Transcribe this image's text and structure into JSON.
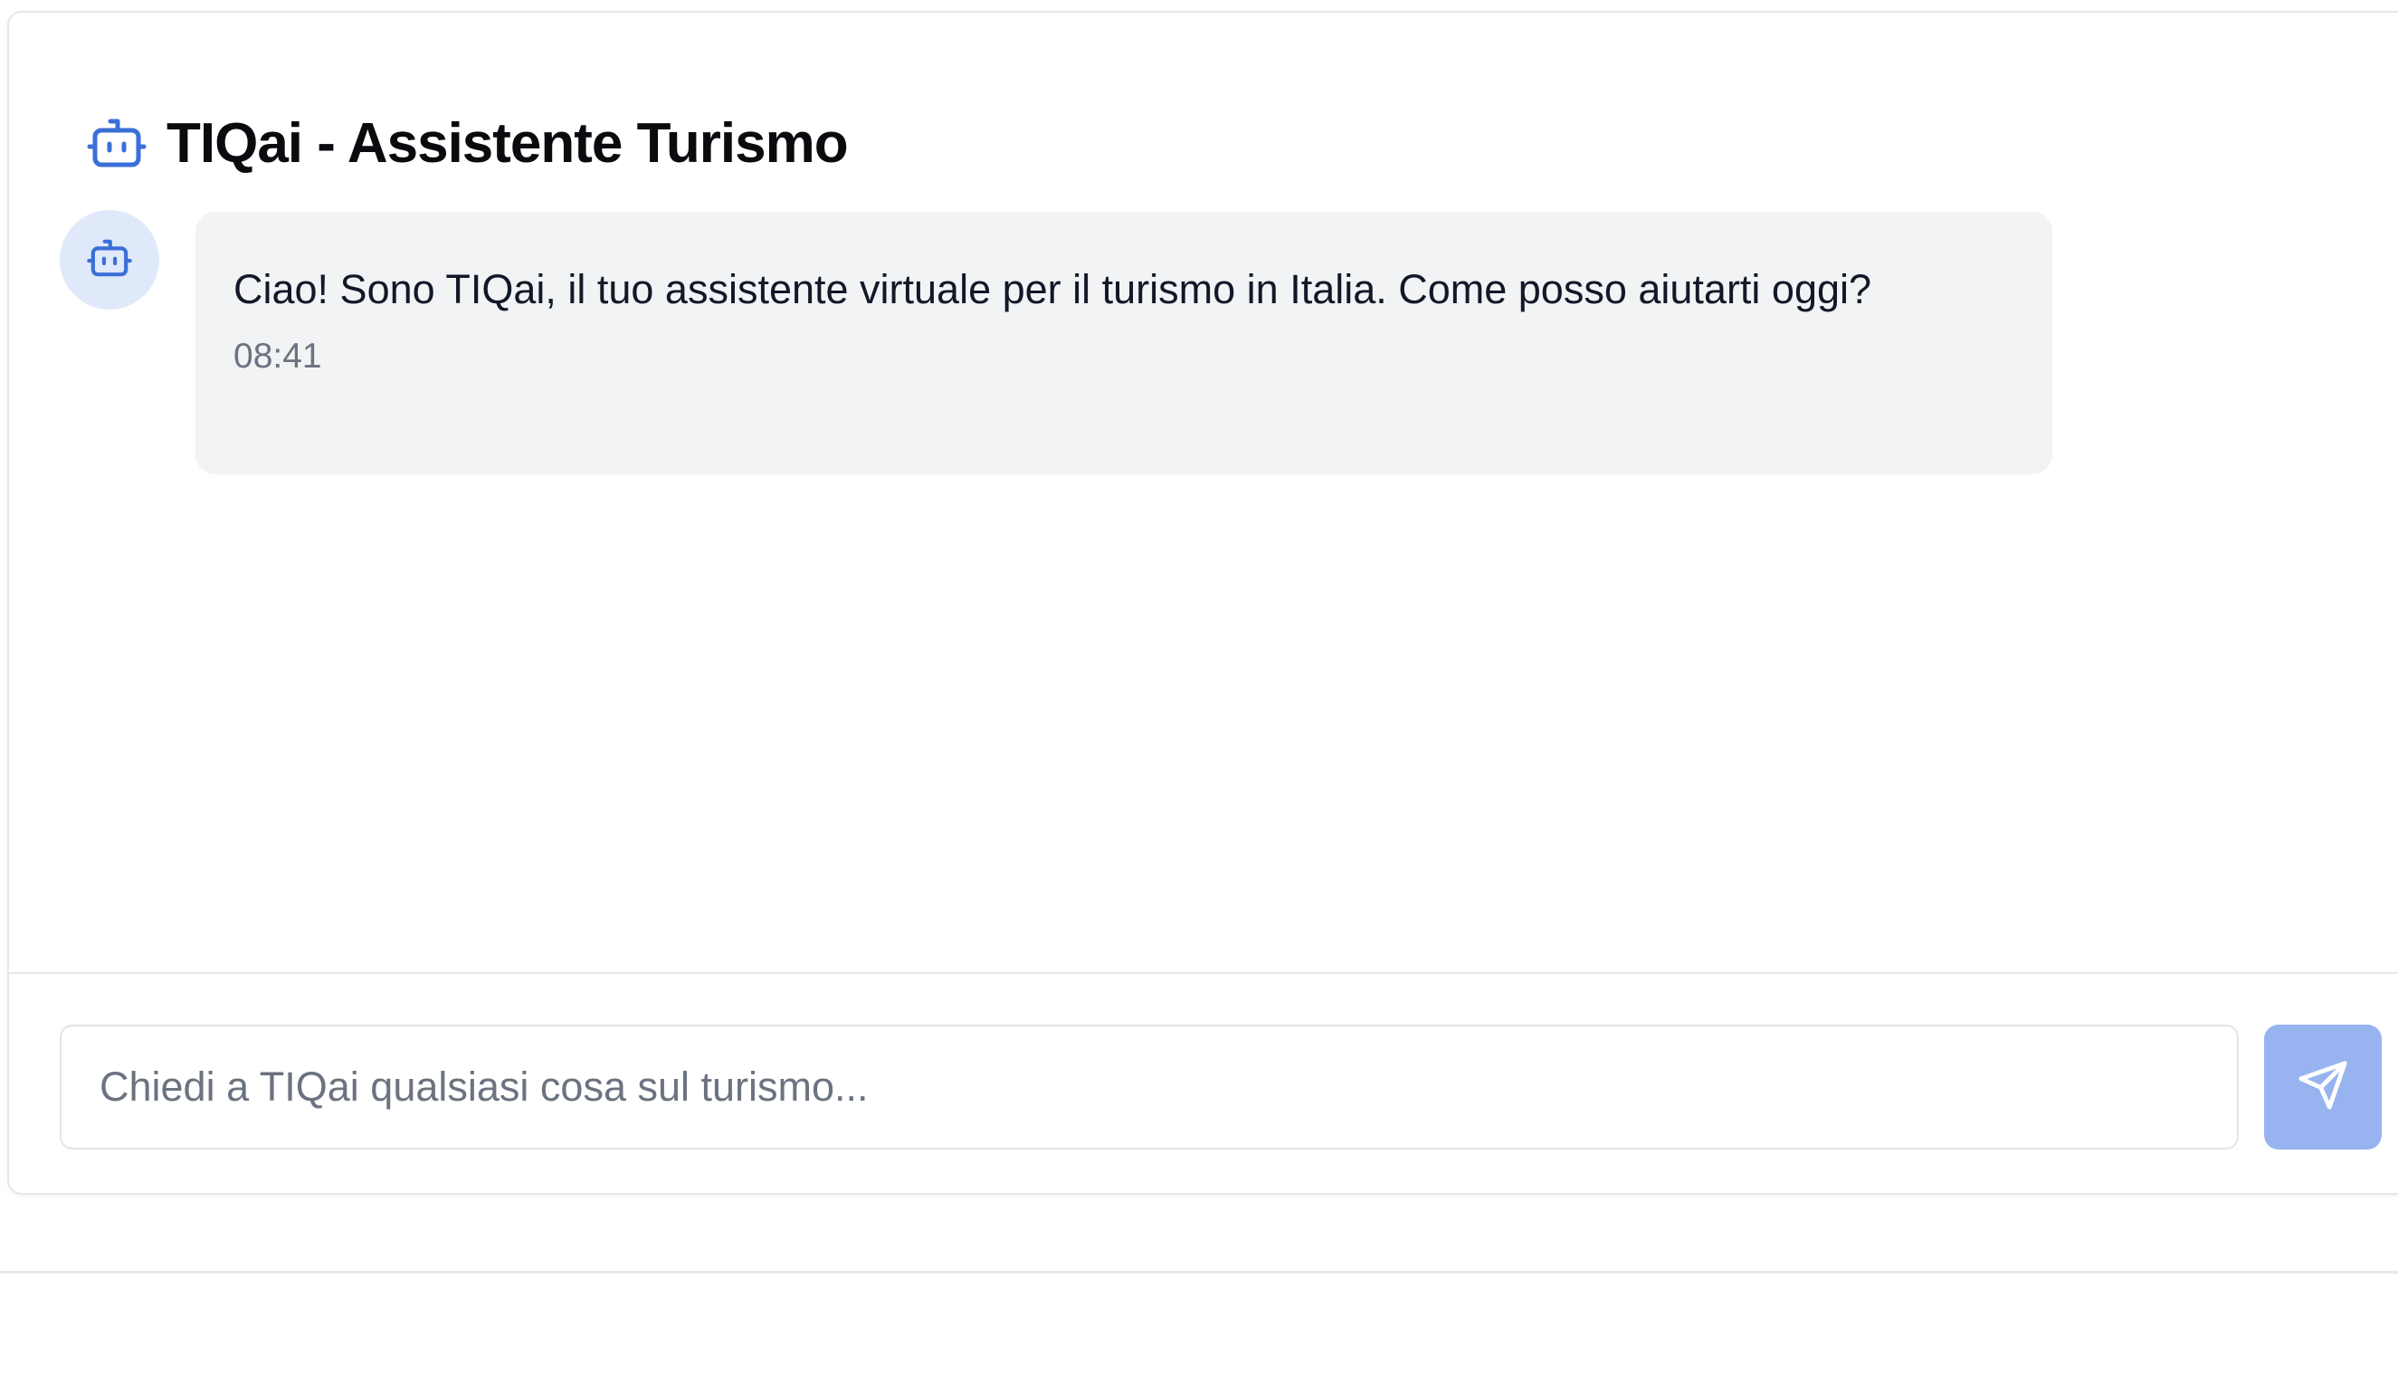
{
  "header": {
    "icon": "bot-icon",
    "title": "TIQai - Assistente Turismo"
  },
  "messages": [
    {
      "sender": "bot",
      "avatar_icon": "bot-icon",
      "text": "Ciao! Sono TIQai, il tuo assistente virtuale per il turismo in Italia. Come posso aiutarti oggi?",
      "time": "08:41"
    }
  ],
  "composer": {
    "value": "",
    "placeholder": "Chiedi a TIQai qualsiasi cosa sul turismo...",
    "send_icon": "send-icon"
  },
  "colors": {
    "accent": "#3b6fd8",
    "avatar_bg": "#dfe9f9",
    "bubble_bg": "#f2f3f5",
    "send_button_bg": "#97b3f0"
  }
}
